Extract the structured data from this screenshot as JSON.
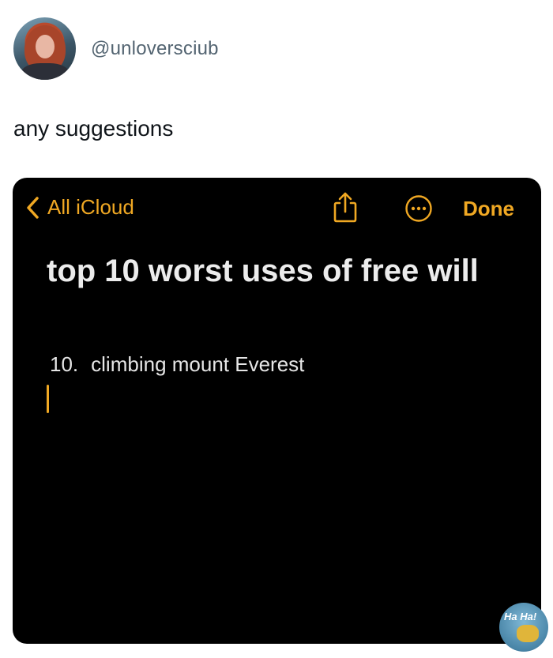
{
  "tweet": {
    "handle": "@unloversciub",
    "text": "any suggestions"
  },
  "note_app": {
    "back_label": "All iCloud",
    "done_label": "Done",
    "title": "top 10 worst uses of free will",
    "list_number": "10.",
    "list_text": "climbing mount Everest",
    "accent_color": "#f0a823",
    "icons": [
      "chevron-left-icon",
      "share-icon",
      "more-icon"
    ]
  },
  "watermark": {
    "text": "Ha Ha!"
  }
}
